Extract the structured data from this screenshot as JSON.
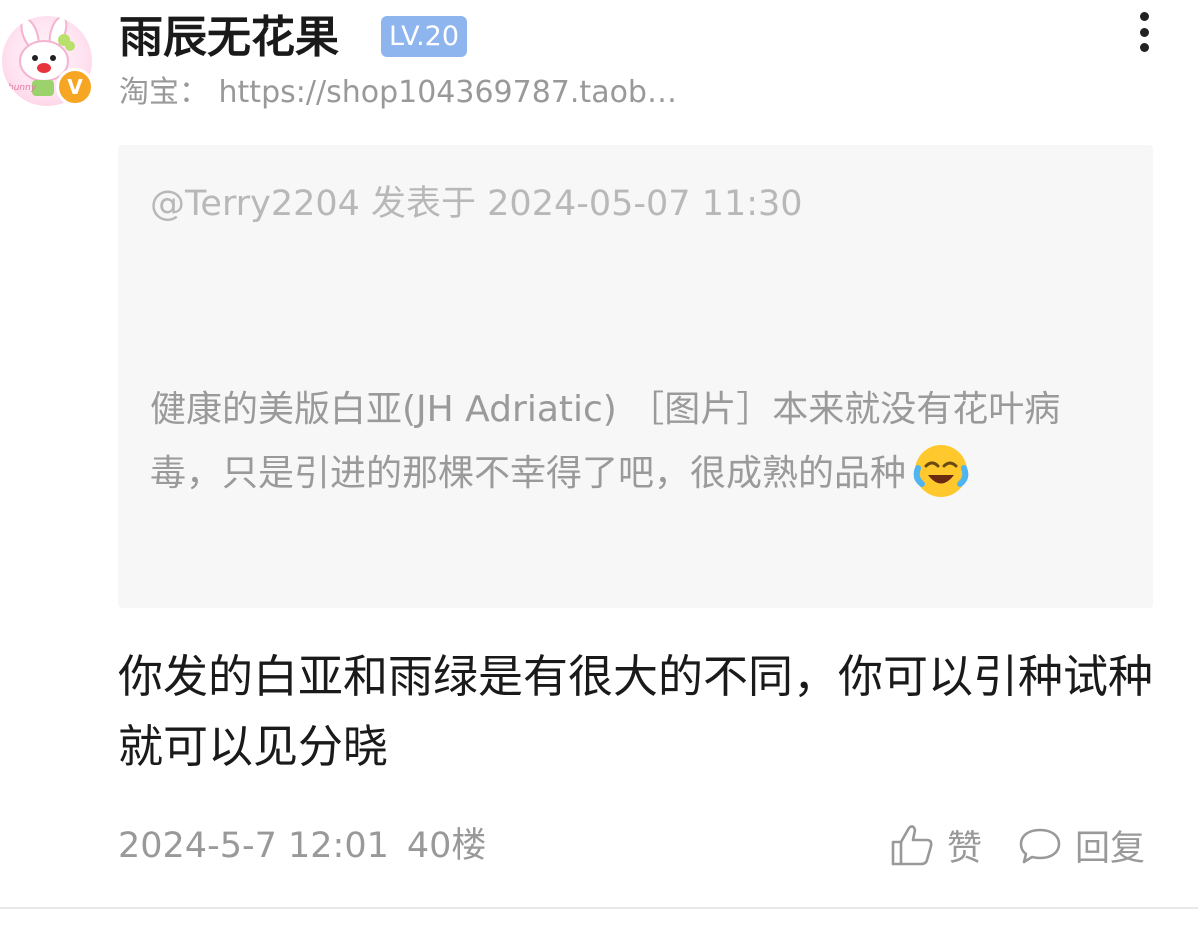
{
  "user": {
    "name": "雨辰无花果",
    "level": "LV.20",
    "verified_badge": "V",
    "subtitle": "淘宝：  https://shop104369787.taob…"
  },
  "quote": {
    "header": "@Terry2204 发表于 2024-05-07 11:30",
    "body": "健康的美版白亚(JH Adriatic) ［图片］本来就没有花叶病毒，只是引进的那棵不幸得了吧，很成熟的品种",
    "emoji": "crying-laughing-emoji"
  },
  "reply": {
    "text": "你发的白亚和雨绿是有很大的不同，你可以引种试种就可以见分晓"
  },
  "meta": {
    "timestamp": "2024-5-7 12:01",
    "floor": "40楼"
  },
  "actions": {
    "like_label": "赞",
    "reply_label": "回复",
    "like_icon": "thumbs-up-icon",
    "reply_icon": "speech-bubble-icon",
    "more_icon": "vertical-dots-icon"
  },
  "colors": {
    "level_badge": "#8fb5ee",
    "verified_badge": "#f6a623",
    "quote_bg": "#f7f7f7",
    "muted_text": "#999999"
  }
}
